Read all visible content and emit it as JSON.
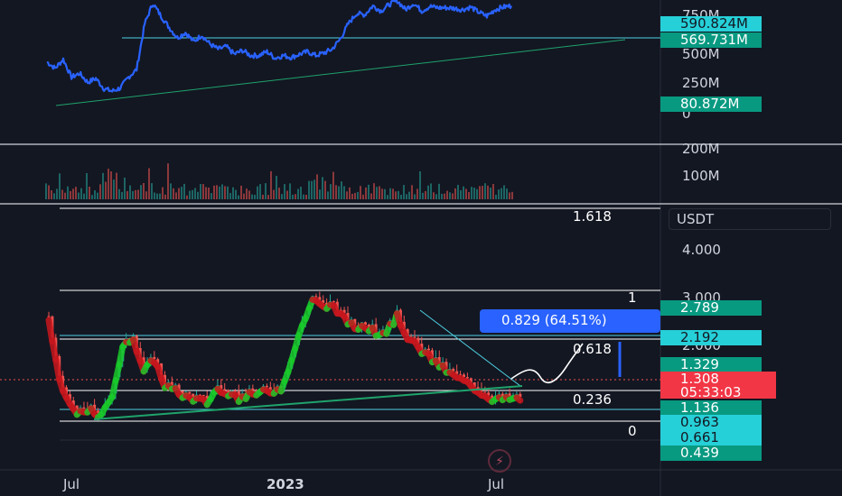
{
  "colors": {
    "background": "#131722",
    "top_line": "#2962ff",
    "teal_line": "#4dd0e1",
    "green_line": "#1fa36b",
    "up_band": "#19c928",
    "down_band": "#c8161d",
    "candle_up": "#26a69a",
    "candle_down": "#ef5350",
    "level_line": "#fff59d",
    "fib_line": "#ffffff",
    "tag_teal": "#26d0d8",
    "tag_green": "#089981",
    "tag_red": "#f23645",
    "tag_blue": "#2962ff"
  },
  "top_panel": {
    "axis_labels": [
      "750M",
      "500M",
      "250M",
      "0"
    ],
    "tags": [
      {
        "text": "590.824M",
        "kind": "teal"
      },
      {
        "text": "569.731M",
        "kind": "green"
      },
      {
        "text": "80.872M",
        "kind": "green"
      }
    ]
  },
  "volume_panel": {
    "axis_labels": [
      "200M",
      "100M"
    ]
  },
  "price_panel": {
    "currency": "USDT",
    "axis_labels": [
      "4.000",
      "3.000",
      "2.000"
    ],
    "fib_labels": [
      "1.618",
      "1",
      "0.618",
      "0.236",
      "0"
    ],
    "measure_text": "0.829 (64.51%)",
    "tags": [
      {
        "text": "2.789",
        "kind": "green"
      },
      {
        "text": "2.192",
        "kind": "teal"
      },
      {
        "text": "1.329",
        "kind": "green"
      },
      {
        "text": "1.308",
        "kind": "red"
      },
      {
        "text": "05:33:03",
        "kind": "red"
      },
      {
        "text": "1.136",
        "kind": "green"
      },
      {
        "text": "0.963",
        "kind": "teal"
      },
      {
        "text": "0.661",
        "kind": "teal"
      },
      {
        "text": "0.439",
        "kind": "green"
      }
    ]
  },
  "time_axis": [
    "Jul",
    "2023",
    "Jul"
  ],
  "chart_data": {
    "type": "line",
    "series": [
      {
        "values": [
          420,
          370,
          440,
          300,
          330,
          260,
          290,
          210,
          190,
          215,
          300,
          360,
          720,
          880,
          780,
          690,
          610,
          650,
          580,
          630,
          560,
          520,
          540,
          480,
          510,
          470,
          470,
          500,
          450,
          470,
          455,
          480,
          500,
          470,
          490,
          520,
          600,
          720,
          800,
          790,
          860,
          820,
          870,
          900,
          830,
          880,
          820,
          855,
          845,
          845,
          840,
          830,
          850,
          810,
          780,
          830,
          850,
          860
        ]
      },
      {
        "values": [
          2.7,
          1.6,
          1.2,
          1.05,
          1.1,
          1.0,
          1.4,
          2.2,
          2.4,
          1.8,
          2.0,
          1.55,
          1.45,
          1.35,
          1.3,
          1.25,
          1.5,
          1.35,
          1.32,
          1.38,
          1.42,
          1.45,
          1.5,
          2.0,
          2.6,
          3.05,
          2.9,
          2.95,
          2.7,
          2.55,
          2.6,
          2.45,
          2.5,
          2.75,
          2.4,
          2.2,
          2.05,
          1.9,
          1.75,
          1.65,
          1.55,
          1.42,
          1.32,
          1.3,
          1.31
        ]
      }
    ]
  }
}
